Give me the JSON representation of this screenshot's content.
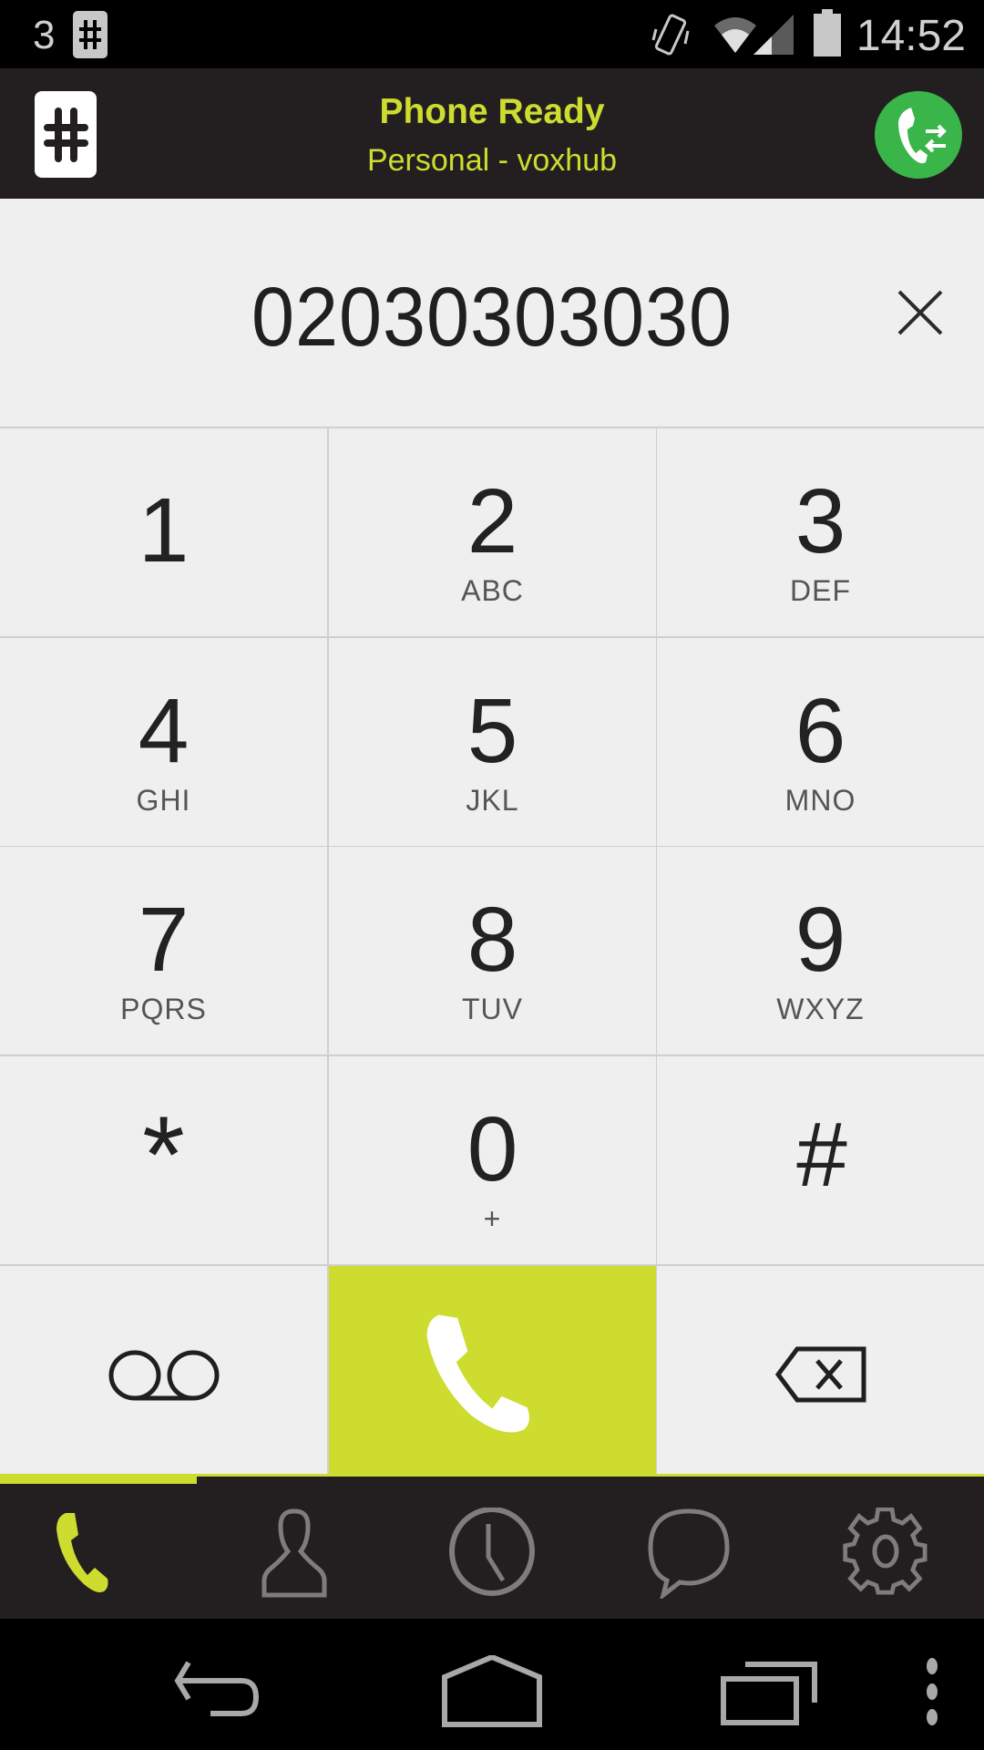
{
  "status_bar": {
    "notification_count": "3",
    "notification_icons": [
      "app-hash-icon"
    ],
    "system_icons": [
      "vibrate-icon",
      "wifi-icon",
      "signal-icon",
      "battery-icon"
    ],
    "time": "14:52"
  },
  "header": {
    "logo_icon": "hash-logo-icon",
    "title": "Phone Ready",
    "subtitle": "Personal - voxhub",
    "action_icon": "call-transfer-icon"
  },
  "dialer": {
    "number": "02030303030",
    "clear_icon": "close-icon"
  },
  "keypad": {
    "keys": [
      {
        "digit": "1",
        "letters": ""
      },
      {
        "digit": "2",
        "letters": "ABC"
      },
      {
        "digit": "3",
        "letters": "DEF"
      },
      {
        "digit": "4",
        "letters": "GHI"
      },
      {
        "digit": "5",
        "letters": "JKL"
      },
      {
        "digit": "6",
        "letters": "MNO"
      },
      {
        "digit": "7",
        "letters": "PQRS"
      },
      {
        "digit": "8",
        "letters": "TUV"
      },
      {
        "digit": "9",
        "letters": "WXYZ"
      },
      {
        "digit": "*",
        "letters": ""
      },
      {
        "digit": "0",
        "letters": "+"
      },
      {
        "digit": "#",
        "letters": ""
      }
    ],
    "actions": [
      {
        "name": "voicemail",
        "icon": "voicemail-icon"
      },
      {
        "name": "call",
        "icon": "phone-icon"
      },
      {
        "name": "backspace",
        "icon": "backspace-icon"
      }
    ]
  },
  "bottom_nav": {
    "active_index": 0,
    "tabs": [
      {
        "name": "dialer",
        "icon": "phone-icon"
      },
      {
        "name": "contacts",
        "icon": "person-icon"
      },
      {
        "name": "recents",
        "icon": "clock-icon"
      },
      {
        "name": "messages",
        "icon": "chat-bubble-icon"
      },
      {
        "name": "settings",
        "icon": "gear-icon"
      }
    ]
  },
  "system_nav": {
    "buttons": [
      "back-icon",
      "home-icon",
      "recents-icon",
      "overflow-menu-icon"
    ]
  },
  "colors": {
    "accent": "#cddc2e",
    "header_bg": "#231f20",
    "transfer_green": "#3ab54a",
    "key_bg": "#efefef",
    "inactive_icon": "#7d7d7d"
  }
}
